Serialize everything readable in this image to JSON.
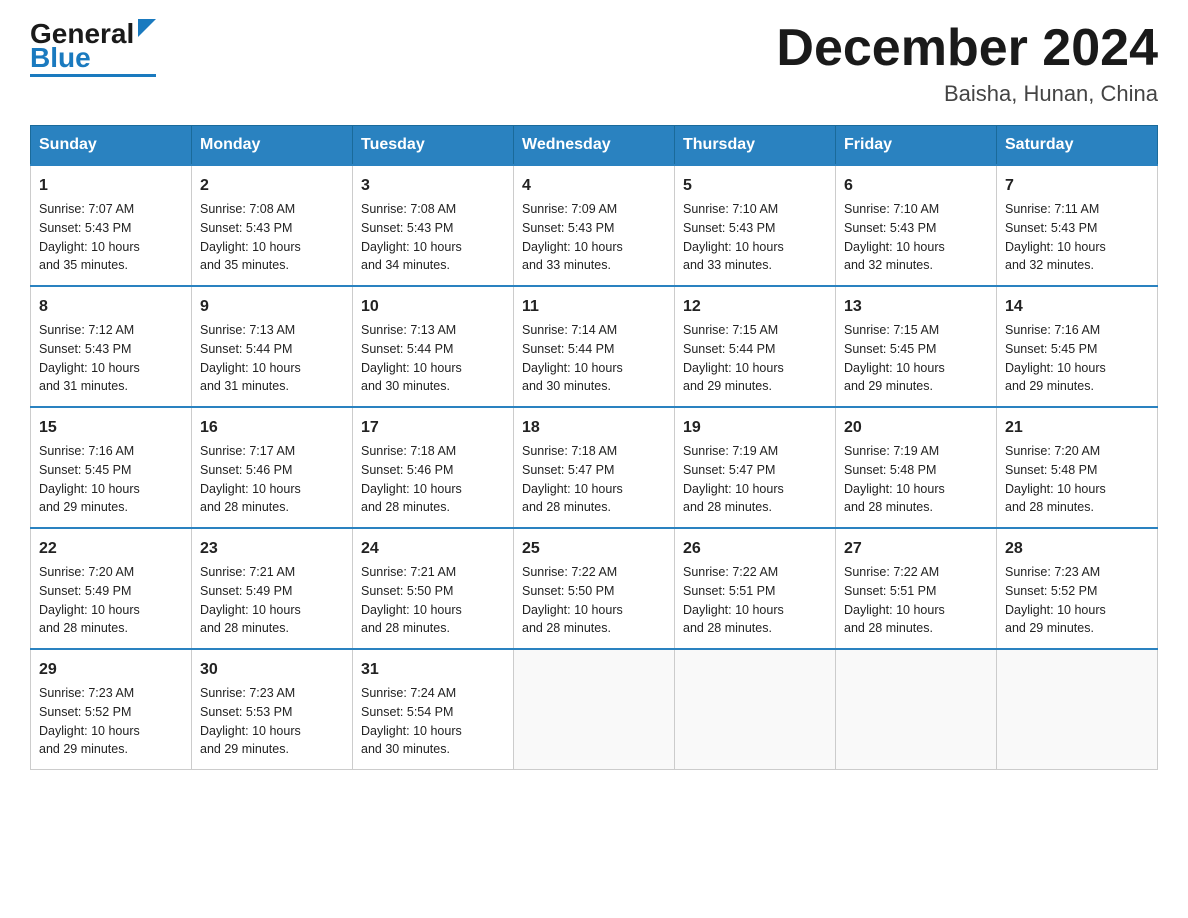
{
  "header": {
    "logo_general": "General",
    "logo_blue": "Blue",
    "month_title": "December 2024",
    "location": "Baisha, Hunan, China"
  },
  "days_of_week": [
    "Sunday",
    "Monday",
    "Tuesday",
    "Wednesday",
    "Thursday",
    "Friday",
    "Saturday"
  ],
  "weeks": [
    [
      {
        "num": "1",
        "sunrise": "7:07 AM",
        "sunset": "5:43 PM",
        "daylight": "10 hours and 35 minutes."
      },
      {
        "num": "2",
        "sunrise": "7:08 AM",
        "sunset": "5:43 PM",
        "daylight": "10 hours and 35 minutes."
      },
      {
        "num": "3",
        "sunrise": "7:08 AM",
        "sunset": "5:43 PM",
        "daylight": "10 hours and 34 minutes."
      },
      {
        "num": "4",
        "sunrise": "7:09 AM",
        "sunset": "5:43 PM",
        "daylight": "10 hours and 33 minutes."
      },
      {
        "num": "5",
        "sunrise": "7:10 AM",
        "sunset": "5:43 PM",
        "daylight": "10 hours and 33 minutes."
      },
      {
        "num": "6",
        "sunrise": "7:10 AM",
        "sunset": "5:43 PM",
        "daylight": "10 hours and 32 minutes."
      },
      {
        "num": "7",
        "sunrise": "7:11 AM",
        "sunset": "5:43 PM",
        "daylight": "10 hours and 32 minutes."
      }
    ],
    [
      {
        "num": "8",
        "sunrise": "7:12 AM",
        "sunset": "5:43 PM",
        "daylight": "10 hours and 31 minutes."
      },
      {
        "num": "9",
        "sunrise": "7:13 AM",
        "sunset": "5:44 PM",
        "daylight": "10 hours and 31 minutes."
      },
      {
        "num": "10",
        "sunrise": "7:13 AM",
        "sunset": "5:44 PM",
        "daylight": "10 hours and 30 minutes."
      },
      {
        "num": "11",
        "sunrise": "7:14 AM",
        "sunset": "5:44 PM",
        "daylight": "10 hours and 30 minutes."
      },
      {
        "num": "12",
        "sunrise": "7:15 AM",
        "sunset": "5:44 PM",
        "daylight": "10 hours and 29 minutes."
      },
      {
        "num": "13",
        "sunrise": "7:15 AM",
        "sunset": "5:45 PM",
        "daylight": "10 hours and 29 minutes."
      },
      {
        "num": "14",
        "sunrise": "7:16 AM",
        "sunset": "5:45 PM",
        "daylight": "10 hours and 29 minutes."
      }
    ],
    [
      {
        "num": "15",
        "sunrise": "7:16 AM",
        "sunset": "5:45 PM",
        "daylight": "10 hours and 29 minutes."
      },
      {
        "num": "16",
        "sunrise": "7:17 AM",
        "sunset": "5:46 PM",
        "daylight": "10 hours and 28 minutes."
      },
      {
        "num": "17",
        "sunrise": "7:18 AM",
        "sunset": "5:46 PM",
        "daylight": "10 hours and 28 minutes."
      },
      {
        "num": "18",
        "sunrise": "7:18 AM",
        "sunset": "5:47 PM",
        "daylight": "10 hours and 28 minutes."
      },
      {
        "num": "19",
        "sunrise": "7:19 AM",
        "sunset": "5:47 PM",
        "daylight": "10 hours and 28 minutes."
      },
      {
        "num": "20",
        "sunrise": "7:19 AM",
        "sunset": "5:48 PM",
        "daylight": "10 hours and 28 minutes."
      },
      {
        "num": "21",
        "sunrise": "7:20 AM",
        "sunset": "5:48 PM",
        "daylight": "10 hours and 28 minutes."
      }
    ],
    [
      {
        "num": "22",
        "sunrise": "7:20 AM",
        "sunset": "5:49 PM",
        "daylight": "10 hours and 28 minutes."
      },
      {
        "num": "23",
        "sunrise": "7:21 AM",
        "sunset": "5:49 PM",
        "daylight": "10 hours and 28 minutes."
      },
      {
        "num": "24",
        "sunrise": "7:21 AM",
        "sunset": "5:50 PM",
        "daylight": "10 hours and 28 minutes."
      },
      {
        "num": "25",
        "sunrise": "7:22 AM",
        "sunset": "5:50 PM",
        "daylight": "10 hours and 28 minutes."
      },
      {
        "num": "26",
        "sunrise": "7:22 AM",
        "sunset": "5:51 PM",
        "daylight": "10 hours and 28 minutes."
      },
      {
        "num": "27",
        "sunrise": "7:22 AM",
        "sunset": "5:51 PM",
        "daylight": "10 hours and 28 minutes."
      },
      {
        "num": "28",
        "sunrise": "7:23 AM",
        "sunset": "5:52 PM",
        "daylight": "10 hours and 29 minutes."
      }
    ],
    [
      {
        "num": "29",
        "sunrise": "7:23 AM",
        "sunset": "5:52 PM",
        "daylight": "10 hours and 29 minutes."
      },
      {
        "num": "30",
        "sunrise": "7:23 AM",
        "sunset": "5:53 PM",
        "daylight": "10 hours and 29 minutes."
      },
      {
        "num": "31",
        "sunrise": "7:24 AM",
        "sunset": "5:54 PM",
        "daylight": "10 hours and 30 minutes."
      },
      null,
      null,
      null,
      null
    ]
  ],
  "labels": {
    "sunrise_prefix": "Sunrise: ",
    "sunset_prefix": "Sunset: ",
    "daylight_prefix": "Daylight: "
  }
}
